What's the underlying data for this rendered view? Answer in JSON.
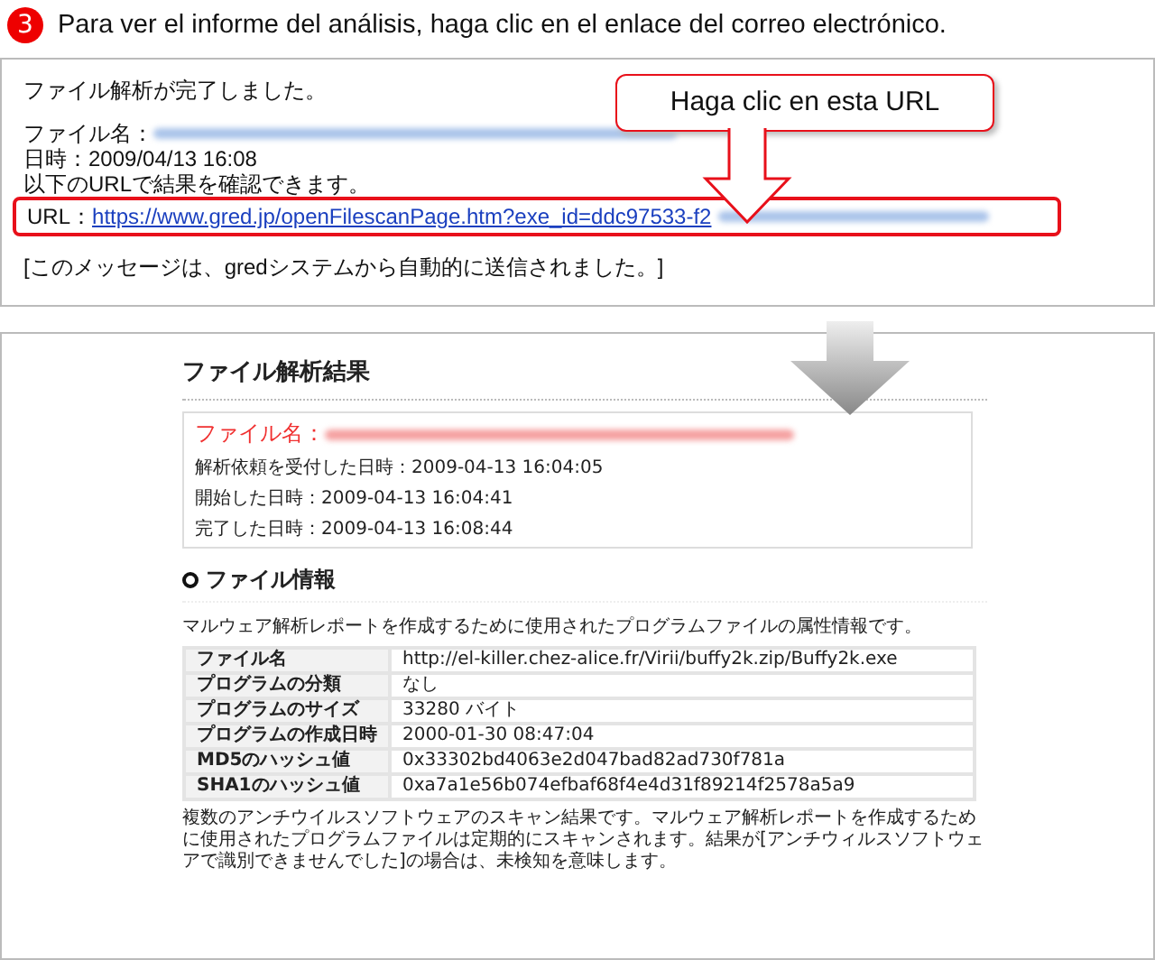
{
  "step": {
    "number": "3",
    "instruction": "Para ver el informe del análisis, haga clic en el enlace del correo electrónico."
  },
  "email": {
    "lines": [
      {
        "kind": "text",
        "text": "ファイル解析が完了しました。"
      },
      {
        "kind": "gap"
      },
      {
        "kind": "blurred",
        "label": "ファイル名："
      },
      {
        "kind": "text",
        "text": "日時：2009/04/13 16:08"
      },
      {
        "kind": "text",
        "text": "以下のURLで結果を確認できます。"
      },
      {
        "kind": "link",
        "label": "URL：",
        "link": "https://www.gred.jp/openFilescanPage.htm?exe_id=ddc97533-f2"
      },
      {
        "kind": "gap"
      },
      {
        "kind": "text",
        "text": "[このメッセージは、gredシステムから自動的に送信されました。]"
      }
    ],
    "callout": "Haga clic en esta URL"
  },
  "report": {
    "title": "ファイル解析結果",
    "file_label": "ファイル名：",
    "times": [
      "解析依頼を受付した日時：2009-04-13 16:04:05",
      "開始した日時：2009-04-13 16:04:41",
      "完了した日時：2009-04-13 16:08:44"
    ],
    "section": "ファイル情報",
    "description": "マルウェア解析レポートを作成するために使用されたプログラムファイルの属性情報です。",
    "table": [
      {
        "label": "ファイル名",
        "value": "http://el-killer.chez-alice.fr/Virii/buffy2k.zip/Buffy2k.exe"
      },
      {
        "label": "プログラムの分類",
        "value": "なし"
      },
      {
        "label": "プログラムのサイズ",
        "value": "33280 バイト"
      },
      {
        "label": "プログラムの作成日時",
        "value": "2000-01-30 08:47:04"
      },
      {
        "label": "MD5のハッシュ値",
        "value": "0x33302bd4063e2d047bad82ad730f781a"
      },
      {
        "label": "SHA1のハッシュ値",
        "value": "0xa7a1e56b074efbaf68f4e4d31f89214f2578a5a9"
      }
    ],
    "note": "複数のアンチウイルスソフトウェアのスキャン結果です。マルウェア解析レポートを作成するために使用されたプログラムファイルは定期的にスキャンされます。結果が[アンチウィルスソフトウェアで識別できませんでした]の場合は、未検知を意味します。"
  }
}
